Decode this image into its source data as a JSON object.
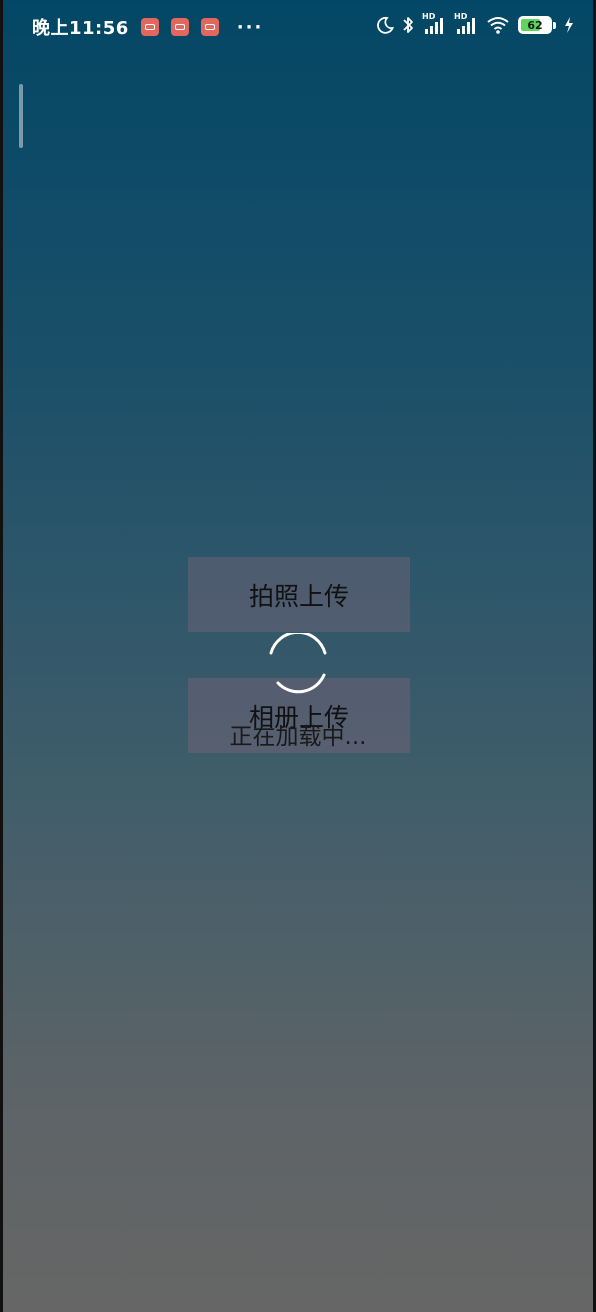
{
  "status_bar": {
    "time": "晚上11:56",
    "app_icons": [
      "notification-app-icon",
      "notification-app-icon",
      "notification-app-icon"
    ],
    "more": "···",
    "battery_level": "62",
    "network_labels": [
      "HD",
      "HD"
    ]
  },
  "upload": {
    "camera_label": "拍照上传",
    "album_label": "相册上传"
  },
  "loading": {
    "text": "正在加载中..."
  },
  "colors": {
    "background_top": "#034766",
    "background_bottom": "#666666",
    "battery_fill": "#5ed65e"
  }
}
